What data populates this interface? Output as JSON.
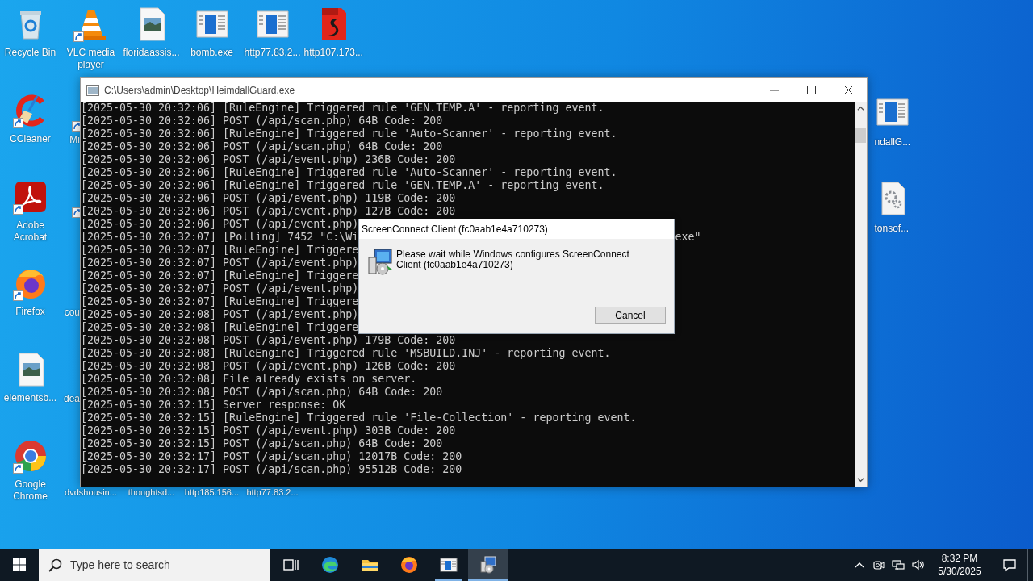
{
  "desktop": {
    "left_column": [
      {
        "label": "Recycle Bin",
        "kind": "recycle",
        "shortcut": false
      },
      {
        "label": "CCleaner",
        "kind": "ccleaner",
        "shortcut": true
      },
      {
        "label": "Adobe Acrobat",
        "kind": "acrobat",
        "shortcut": true
      },
      {
        "label": "Firefox",
        "kind": "firefox",
        "shortcut": true
      },
      {
        "label": "elementsb...",
        "kind": "image",
        "shortcut": false
      },
      {
        "label": "Google Chrome",
        "kind": "chrome",
        "shortcut": true
      }
    ],
    "top_row": [
      {
        "label": "VLC media player",
        "kind": "vlc",
        "shortcut": true
      },
      {
        "label": "floridaassis...",
        "kind": "image",
        "shortcut": false
      },
      {
        "label": "bomb.exe",
        "kind": "window",
        "shortcut": false
      },
      {
        "label": "http77.83.2...",
        "kind": "window",
        "shortcut": false
      },
      {
        "label": "http107.173...",
        "kind": "pdf",
        "shortcut": false
      }
    ],
    "covered_column": [
      {
        "label": "Mi",
        "shortcut": true
      },
      {
        "shortcut": true
      },
      {
        "label": "cou",
        "shortcut": false
      },
      {
        "label": "dea",
        "shortcut": false
      }
    ],
    "bottom_row_labels": [
      "dvdshousin...",
      "thoughtsd...",
      "http185.156...",
      "http77.83.2..."
    ],
    "right_column": [
      {
        "label": "ndallG...",
        "kind": "window"
      },
      {
        "label": "tonsof...",
        "kind": "gearfile"
      }
    ]
  },
  "console_window": {
    "title": "C:\\Users\\admin\\Desktop\\HeimdallGuard.exe",
    "lines": [
      {
        "text": "[2025-05-30 20:32:06] [RuleEngine] Triggered rule 'GEN.TEMP.A' - reporting event."
      },
      {
        "text": "[2025-05-30 20:32:06] POST (/api/scan.php) 64B Code: 200"
      },
      {
        "text": "[2025-05-30 20:32:06] [RuleEngine] Triggered rule 'Auto-Scanner' - reporting event."
      },
      {
        "text": "[2025-05-30 20:32:06] POST (/api/scan.php) 64B Code: 200"
      },
      {
        "text": "[2025-05-30 20:32:06] POST (/api/event.php) 236B Code: 200"
      },
      {
        "text": "[2025-05-30 20:32:06] [RuleEngine] Triggered rule 'Auto-Scanner' - reporting event."
      },
      {
        "text": "[2025-05-30 20:32:06] [RuleEngine] Triggered rule 'GEN.TEMP.A' - reporting event."
      },
      {
        "text": "[2025-05-30 20:32:06] POST (/api/event.php) 119B Code: 200"
      },
      {
        "text": "[2025-05-30 20:32:06] POST (/api/event.php) 127B Code: 200"
      },
      {
        "text": "[2025-05-30 20:32:06] POST (/api/event.php)"
      },
      {
        "text": "[2025-05-30 20:32:07] [Polling] 7452 \"C:\\Wi",
        "tail": "exe\""
      },
      {
        "text": "[2025-05-30 20:32:07] [RuleEngine] Triggere"
      },
      {
        "text": "[2025-05-30 20:32:07] POST (/api/event.php)"
      },
      {
        "text": "[2025-05-30 20:32:07] [RuleEngine] Triggere"
      },
      {
        "text": "[2025-05-30 20:32:07] POST (/api/event.php)"
      },
      {
        "text": "[2025-05-30 20:32:07] [RuleEngine] Triggere"
      },
      {
        "text": "[2025-05-30 20:32:08] POST (/api/event.php)"
      },
      {
        "text": "[2025-05-30 20:32:08] [RuleEngine] Triggere"
      },
      {
        "text": "[2025-05-30 20:32:08] POST (/api/event.php) 179B Code: 200"
      },
      {
        "text": "[2025-05-30 20:32:08] [RuleEngine] Triggered rule 'MSBUILD.INJ' - reporting event."
      },
      {
        "text": "[2025-05-30 20:32:08] POST (/api/event.php) 126B Code: 200"
      },
      {
        "text": "[2025-05-30 20:32:08] File already exists on server."
      },
      {
        "text": "[2025-05-30 20:32:08] POST (/api/scan.php) 64B Code: 200"
      },
      {
        "text": "[2025-05-30 20:32:15] Server response: OK"
      },
      {
        "text": "[2025-05-30 20:32:15] [RuleEngine] Triggered rule 'File-Collection' - reporting event."
      },
      {
        "text": "[2025-05-30 20:32:15] POST (/api/event.php) 303B Code: 200"
      },
      {
        "text": "[2025-05-30 20:32:15] POST (/api/scan.php) 64B Code: 200"
      },
      {
        "text": "[2025-05-30 20:32:17] POST (/api/scan.php) 12017B Code: 200"
      },
      {
        "text": "[2025-05-30 20:32:17] POST (/api/scan.php) 95512B Code: 200"
      }
    ]
  },
  "dialog": {
    "title": "ScreenConnect Client (fc0aab1e4a710273)",
    "message": "Please wait while Windows configures ScreenConnect Client (fc0aab1e4a710273)",
    "button": "Cancel"
  },
  "taskbar": {
    "search": {
      "placeholder": "Type here to search"
    },
    "apps": [
      {
        "kind": "taskview",
        "running": false,
        "selected": false
      },
      {
        "kind": "edge",
        "running": false,
        "selected": false
      },
      {
        "kind": "explorer",
        "running": false,
        "selected": false
      },
      {
        "kind": "firefox",
        "running": false,
        "selected": false
      },
      {
        "kind": "console",
        "running": true,
        "selected": false
      },
      {
        "kind": "installer",
        "running": true,
        "selected": true
      }
    ],
    "tray": [
      {
        "kind": "chevron"
      },
      {
        "kind": "camera"
      },
      {
        "kind": "network"
      },
      {
        "kind": "volume"
      }
    ],
    "time": "8:32 PM",
    "date": "5/30/2025"
  }
}
